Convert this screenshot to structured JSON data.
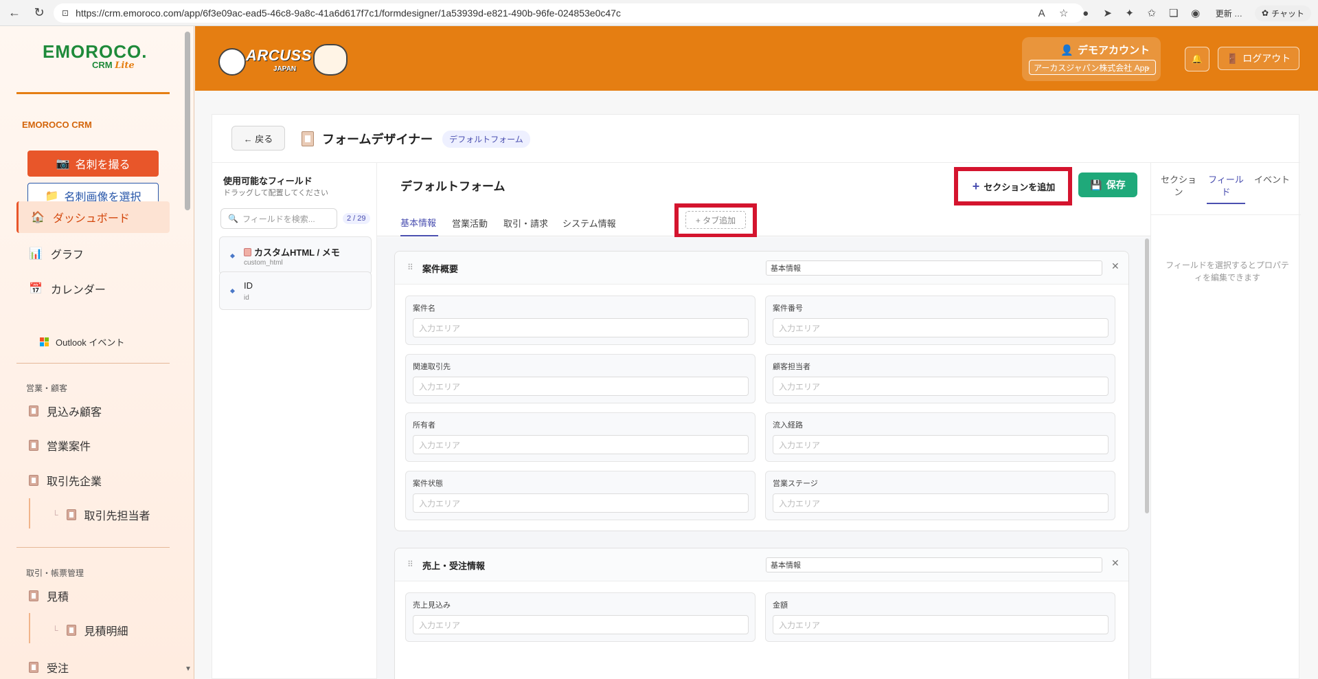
{
  "browser": {
    "url": "https://crm.emoroco.com/app/6f3e09ac-ead5-46c8-9a8c-41a6d617f7c1/formdesigner/1a53939d-e821-490b-96fe-024853e0c47c",
    "update_label": "更新",
    "chat_label": "チャット"
  },
  "sidebar": {
    "logo_main": "EMOROCO.",
    "logo_crm": "CRM",
    "logo_lite": "Lite",
    "brand_title": "EMOROCO CRM",
    "card_button": "名刺を撮る",
    "image_button": "名刺画像を選択",
    "items": {
      "dashboard": "ダッシュボード",
      "graph": "グラフ",
      "calendar": "カレンダー",
      "outlook": "Outlook イベント"
    },
    "group_sales": "営業・顧客",
    "sales_items": [
      "見込み顧客",
      "営業案件",
      "取引先企業",
      "取引先担当者"
    ],
    "group_docs": "取引・帳票管理",
    "doc_items": [
      "見積",
      "見積明細",
      "受注"
    ]
  },
  "header": {
    "brand": "ARCUSS",
    "brand_sub": "JAPAN",
    "account_name": "デモアカウント",
    "org_select": "アーカスジャパン株式会社 App",
    "logout_label": "ログアウト"
  },
  "designer": {
    "back_label": "← 戻る",
    "title": "フォームデザイナー",
    "form_chip": "デフォルトフォーム",
    "left_title": "使用可能なフィールド",
    "left_sub": "ドラッグして配置してください",
    "search_placeholder": "フィールドを検索...",
    "field_count": "2 / 29",
    "fields": [
      {
        "name": "カスタムHTML / メモ",
        "key": "custom_html"
      },
      {
        "name": "ID",
        "key": "id"
      }
    ],
    "form_title": "デフォルトフォーム",
    "add_section_label": "セクションを追加",
    "save_label": "保存",
    "tabs": [
      "基本情報",
      "営業活動",
      "取引・請求",
      "システム情報"
    ],
    "tab_add_label": "+ タブ追加",
    "input_placeholder": "入力エリア",
    "sections": [
      {
        "name": "案件概要",
        "tab": "基本情報",
        "fields": [
          "案件名",
          "案件番号",
          "関連取引先",
          "顧客担当者",
          "所有者",
          "流入経路",
          "案件状態",
          "営業ステージ"
        ]
      },
      {
        "name": "売上・受注情報",
        "tab": "基本情報",
        "fields": [
          "売上見込み",
          "金額"
        ]
      }
    ],
    "right_tabs": [
      "セクション",
      "フィールド",
      "イベント"
    ],
    "right_hint": "フィールドを選択するとプロパティを編集できます"
  }
}
